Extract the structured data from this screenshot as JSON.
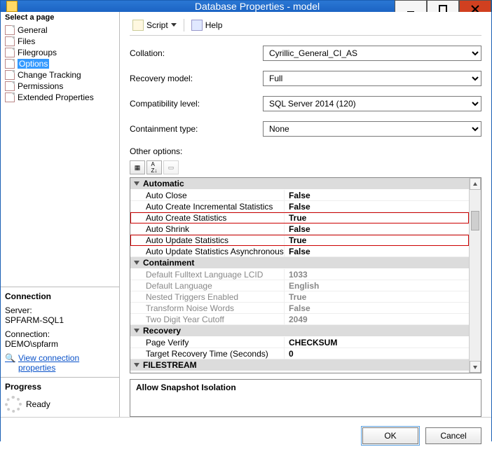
{
  "window": {
    "title": "Database Properties - model"
  },
  "leftpane": {
    "section": "Select a page",
    "items": [
      {
        "label": "General"
      },
      {
        "label": "Files"
      },
      {
        "label": "Filegroups"
      },
      {
        "label": "Options",
        "selected": true
      },
      {
        "label": "Change Tracking"
      },
      {
        "label": "Permissions"
      },
      {
        "label": "Extended Properties"
      }
    ]
  },
  "connection": {
    "title": "Connection",
    "server_label": "Server:",
    "server_value": "SPFARM-SQL1",
    "conn_label": "Connection:",
    "conn_value": "DEMO\\spfarm",
    "link_text": "View connection properties"
  },
  "progress": {
    "title": "Progress",
    "status": "Ready"
  },
  "toolbar": {
    "script": "Script",
    "help": "Help"
  },
  "form": {
    "collation_label": "Collation:",
    "collation_value": "Cyrillic_General_CI_AS",
    "recovery_label": "Recovery model:",
    "recovery_value": "Full",
    "compat_label": "Compatibility level:",
    "compat_value": "SQL Server 2014 (120)",
    "contain_label": "Containment type:",
    "contain_value": "None",
    "other_label": "Other options:"
  },
  "grid": {
    "cat_auto": "Automatic",
    "auto_close_k": "Auto Close",
    "auto_close_v": "False",
    "auto_cis_k": "Auto Create Incremental Statistics",
    "auto_cis_v": "False",
    "auto_cs_k": "Auto Create Statistics",
    "auto_cs_v": "True",
    "auto_shrink_k": "Auto Shrink",
    "auto_shrink_v": "False",
    "auto_us_k": "Auto Update Statistics",
    "auto_us_v": "True",
    "auto_usa_k": "Auto Update Statistics Asynchronously",
    "auto_usa_v": "False",
    "cat_cont": "Containment",
    "lcid_k": "Default Fulltext Language LCID",
    "lcid_v": "1033",
    "lang_k": "Default Language",
    "lang_v": "English",
    "nest_k": "Nested Triggers Enabled",
    "nest_v": "True",
    "noise_k": "Transform Noise Words",
    "noise_v": "False",
    "year_k": "Two Digit Year Cutoff",
    "year_v": "2049",
    "cat_rec": "Recovery",
    "pv_k": "Page Verify",
    "pv_v": "CHECKSUM",
    "trt_k": "Target Recovery Time (Seconds)",
    "trt_v": "0",
    "cat_fs": "FILESTREAM"
  },
  "help_panel": "Allow Snapshot Isolation",
  "buttons": {
    "ok": "OK",
    "cancel": "Cancel"
  }
}
